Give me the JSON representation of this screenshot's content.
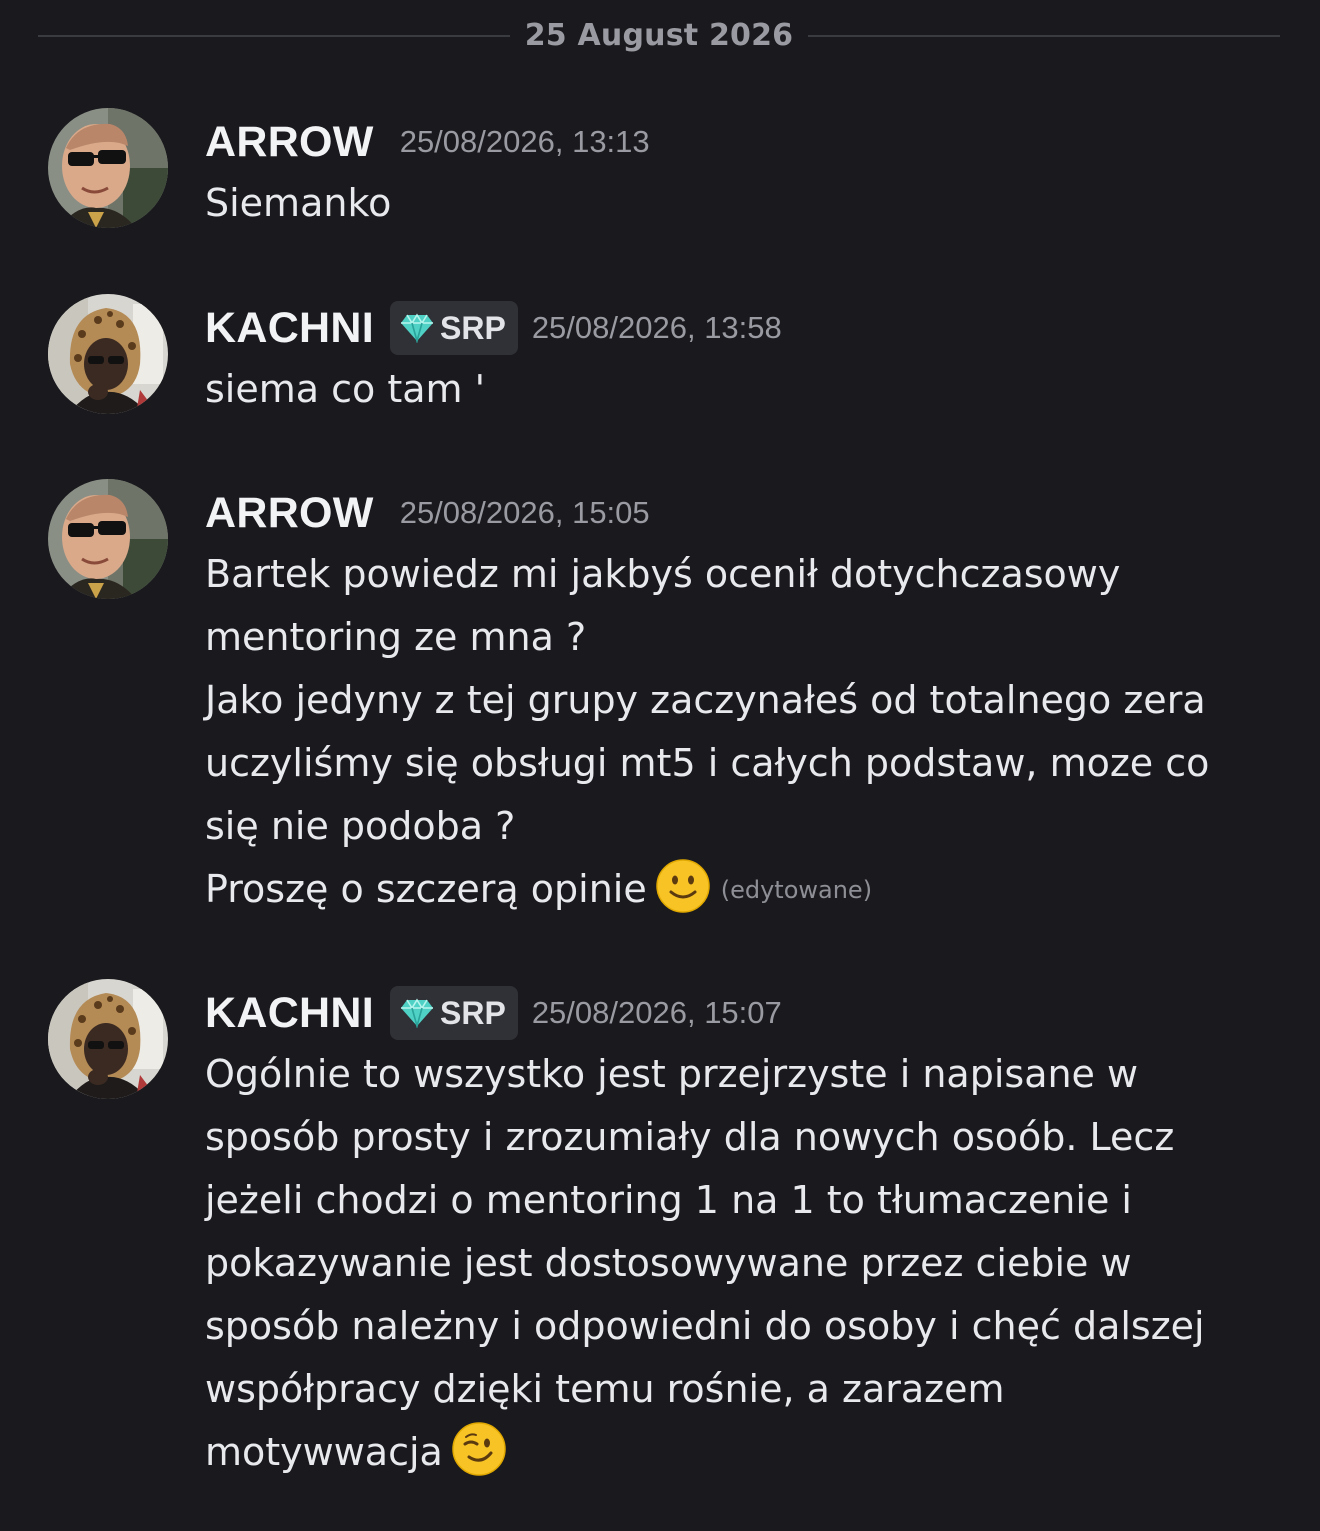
{
  "date_divider": "25 August 2026",
  "colors": {
    "background": "#1a1a1e",
    "tag_background": "#303136",
    "gem": "#4fd1c5",
    "emoji_yellow": "#f7c325"
  },
  "messages": [
    {
      "author": "ARROW",
      "timestamp": "25/08/2026, 13:13",
      "lines": [
        "Siemanko"
      ]
    },
    {
      "author": "KACHNI",
      "tag": {
        "icon": "gem-icon",
        "label": "SRP"
      },
      "timestamp": "25/08/2026, 13:58",
      "lines": [
        "siema co tam '"
      ]
    },
    {
      "author": "ARROW",
      "timestamp": "25/08/2026, 15:05",
      "lines": [
        "Bartek powiedz mi jakbyś ocenił dotychczasowy",
        "mentoring ze mna ?",
        "Jako jedyny z tej grupy zaczynałeś od totalnego zera",
        "uczyliśmy się obsługi mt5 i całych podstaw, moze co",
        "się nie podoba ?",
        "Proszę o szczerą opinie"
      ],
      "trailing_emoji": "slightly-smiling-face-emoji",
      "edited_label": "(edytowane)"
    },
    {
      "author": "KACHNI",
      "tag": {
        "icon": "gem-icon",
        "label": "SRP"
      },
      "timestamp": "25/08/2026, 15:07",
      "lines": [
        "Ogólnie to wszystko jest przejrzyste i napisane w",
        "sposób prosty i zrozumiały dla nowych osoób. Lecz",
        "jeżeli chodzi o  mentoring 1 na 1 to tłumaczenie i",
        "pokazywanie jest dostosowywane przez ciebie w",
        "sposób należny i odpowiedni do osoby i chęć dalszej",
        "współpracy dzięki temu rośnie, a zarazem",
        "motywwacja"
      ],
      "trailing_emoji": "winking-face-emoji"
    }
  ]
}
